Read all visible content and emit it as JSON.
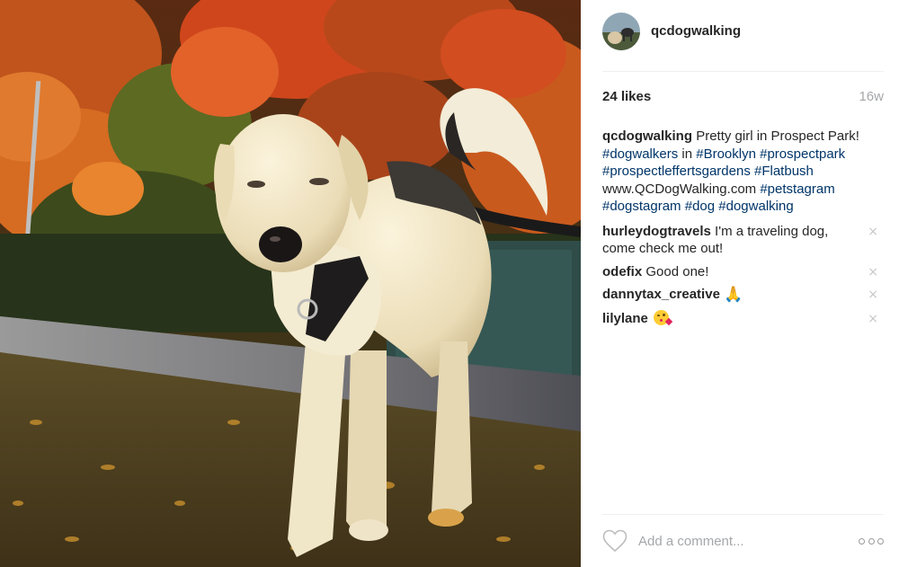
{
  "post": {
    "username": "qcdogwalking",
    "likes": "24 likes",
    "time": "16w",
    "caption": {
      "author": "qcdogwalking",
      "text": "Pretty girl in Prospect Park!",
      "tag_dogwalkers": "#dogwalkers",
      "in_word": "in",
      "tag_brooklyn": "#Brooklyn",
      "tag_prospectpark": "#prospectpark",
      "tag_prospectlefferts": "#prospectleffertsgardens",
      "tag_flatbush": "#Flatbush",
      "website": "www.QCDogWalking.com",
      "tag_petstagram": "#petstagram",
      "tag_dogstagram": "#dogstagram",
      "tag_dog": "#dog",
      "tag_dogwalking": "#dogwalking"
    },
    "comments": [
      {
        "author": "hurleydogtravels",
        "text": "I'm a traveling dog, come check me out!"
      },
      {
        "author": "odefix",
        "text": "Good one!"
      },
      {
        "author": "dannytax_creative",
        "text": "",
        "emoji": "praying-hands"
      },
      {
        "author": "lilylane",
        "text": "",
        "emoji": "kissing-face"
      }
    ],
    "remove_glyph": "×",
    "pray_glyph": "🙏",
    "add_comment_placeholder": "Add a comment...",
    "icons": {
      "like": "heart-outline-icon",
      "more": "more-options-icon",
      "remove": "remove-comment-icon"
    },
    "colors": {
      "hashtag": "#003569",
      "text": "#262626",
      "muted": "#a5a7aa",
      "divider": "#efefef"
    }
  }
}
